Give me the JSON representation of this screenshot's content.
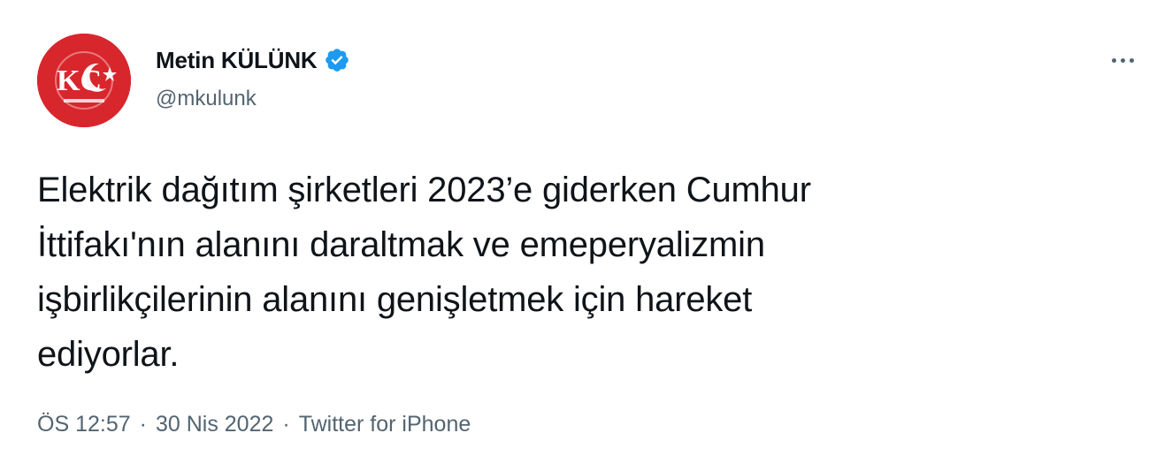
{
  "author": {
    "display_name": "Metin KÜLÜNK",
    "handle": "@mkulunk",
    "avatar_icon": "crescent-star-logo-icon",
    "verified_icon": "verified-badge-icon",
    "avatar_color": "#d8262d",
    "verified_color": "#1d9bf0"
  },
  "tweet": {
    "lines": [
      "Elektrik dağıtım şirketleri 2023’e giderken Cumhur",
      "İttifakı'nın alanını daraltmak ve emeperyalizmin",
      "işbirlikçilerinin alanını genişletmek için hareket",
      "ediyorlar."
    ]
  },
  "meta": {
    "time": "ÖS 12:57",
    "separator": "·",
    "date": "30 Nis 2022",
    "source": "Twitter for iPhone"
  },
  "menu": {
    "more_icon": "more-options-icon"
  }
}
